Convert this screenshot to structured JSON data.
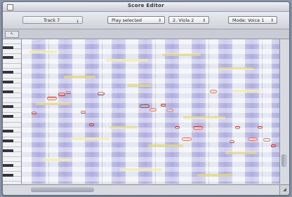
{
  "window": {
    "title": "Score Editor"
  },
  "toolbar": {
    "track": {
      "value": "Track 7",
      "arrow": "↓"
    },
    "play": {
      "value": "Play selected",
      "arrow": "⇕"
    },
    "voice": {
      "value": "2. Viola 2",
      "arrow": "⇕"
    },
    "mode": {
      "value": "Mode: Voice 1",
      "arrow": "⇕"
    }
  },
  "ruler": {
    "tool_glyph": "↖"
  },
  "colors": {
    "note_outline": "#c4311c",
    "ghost_note": "#ebe178",
    "grid_band": "#b2b0e2"
  },
  "icons": [
    "close-box-icon",
    "pointer-tool-icon",
    "grow-box-icon"
  ]
}
